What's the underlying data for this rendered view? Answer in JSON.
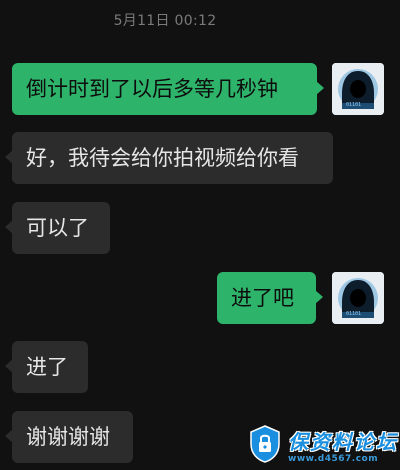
{
  "chat": {
    "timestamp": "5月11日 00:12",
    "messages": [
      {
        "side": "out",
        "text": "倒计时到了以后多等几秒钟"
      },
      {
        "side": "in",
        "text": "好，我待会给你拍视频给你看"
      },
      {
        "side": "in",
        "text": "可以了"
      },
      {
        "side": "out",
        "text": "进了吧"
      },
      {
        "side": "in",
        "text": "进了"
      },
      {
        "side": "in",
        "text": "谢谢谢谢"
      }
    ]
  },
  "watermark": {
    "title": "保资料论坛",
    "url": "www.d4567.com"
  },
  "colors": {
    "background": "#111111",
    "outgoing_bubble": "#2eb36a",
    "incoming_bubble": "#2c2c2c",
    "timestamp": "#7a7a7a",
    "watermark": "#1a8fe0"
  },
  "icons": {
    "avatar": "hooded-hacker-avatar-icon",
    "watermark_logo": "lock-shield-icon"
  }
}
